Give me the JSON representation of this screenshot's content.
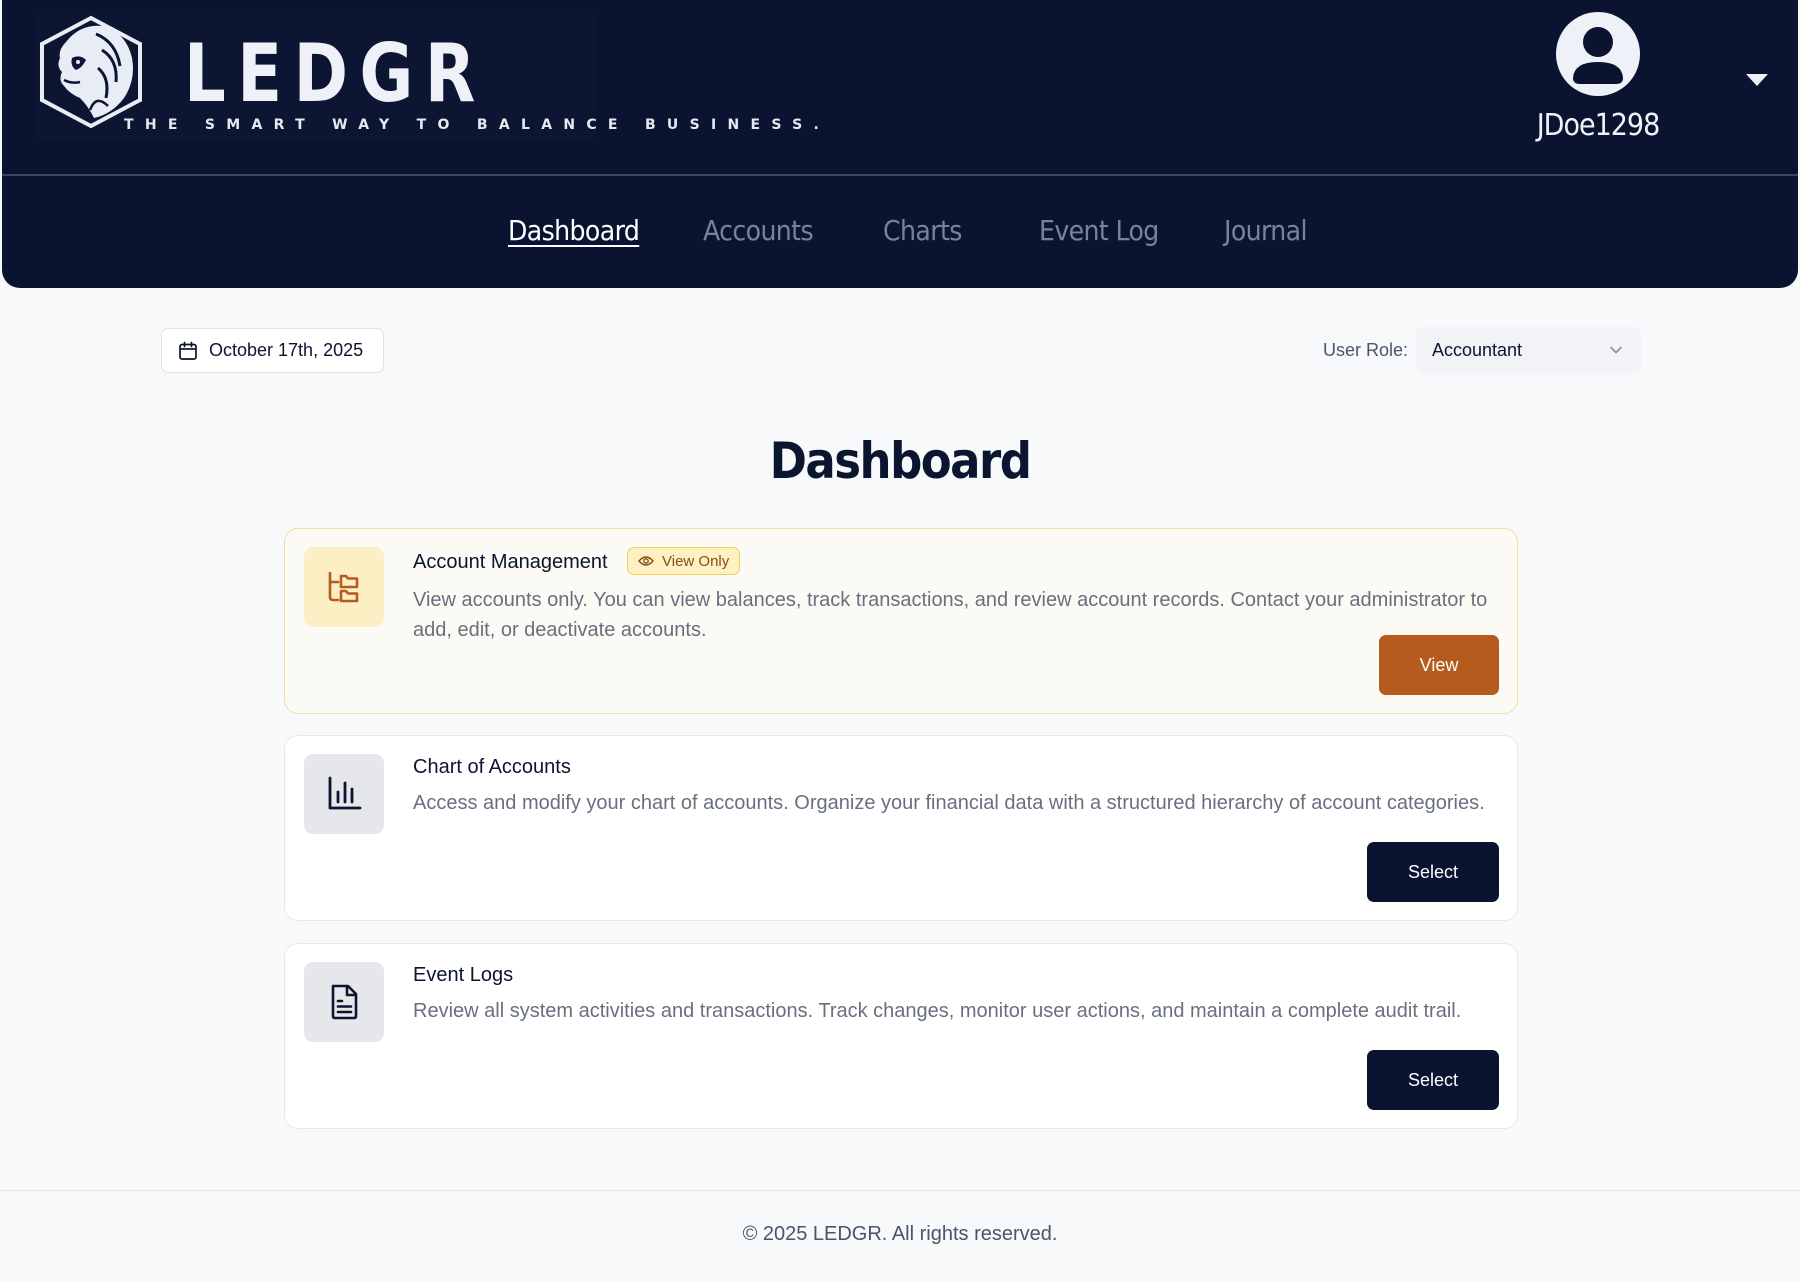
{
  "brand": {
    "name": "LEDGR",
    "tagline": "THE SMART WAY TO BALANCE BUSINESS."
  },
  "user": {
    "username": "JDoe1298"
  },
  "nav": {
    "items": [
      {
        "label": "Dashboard",
        "active": true
      },
      {
        "label": "Accounts",
        "active": false
      },
      {
        "label": "Charts",
        "active": false
      },
      {
        "label": "Event Log",
        "active": false
      },
      {
        "label": "Journal",
        "active": false
      }
    ]
  },
  "toolbar": {
    "date": "October 17th, 2025",
    "role_label": "User Role:",
    "role_value": "Accountant"
  },
  "page": {
    "title": "Dashboard"
  },
  "cards": [
    {
      "title": "Account Management",
      "badge": "View Only",
      "description": "View accounts only. You can view balances, track transactions, and review account records. Contact your administrator to add, edit, or deactivate accounts.",
      "button": "View",
      "icon": "folder-tree-icon"
    },
    {
      "title": "Chart of Accounts",
      "description": "Access and modify your chart of accounts. Organize your financial data with a structured hierarchy of account categories.",
      "button": "Select",
      "icon": "bar-chart-icon"
    },
    {
      "title": "Event Logs",
      "description": "Review all system activities and transactions. Track changes, monitor user actions, and maintain a complete audit trail.",
      "button": "Select",
      "icon": "file-text-icon"
    }
  ],
  "footer": {
    "copyright": "© 2025 LEDGR. All rights reserved."
  },
  "colors": {
    "header_bg": "#0a1430",
    "accent_orange": "#b55b1e",
    "badge_bg": "#fdf1c3",
    "primary_button": "#0a1430"
  }
}
